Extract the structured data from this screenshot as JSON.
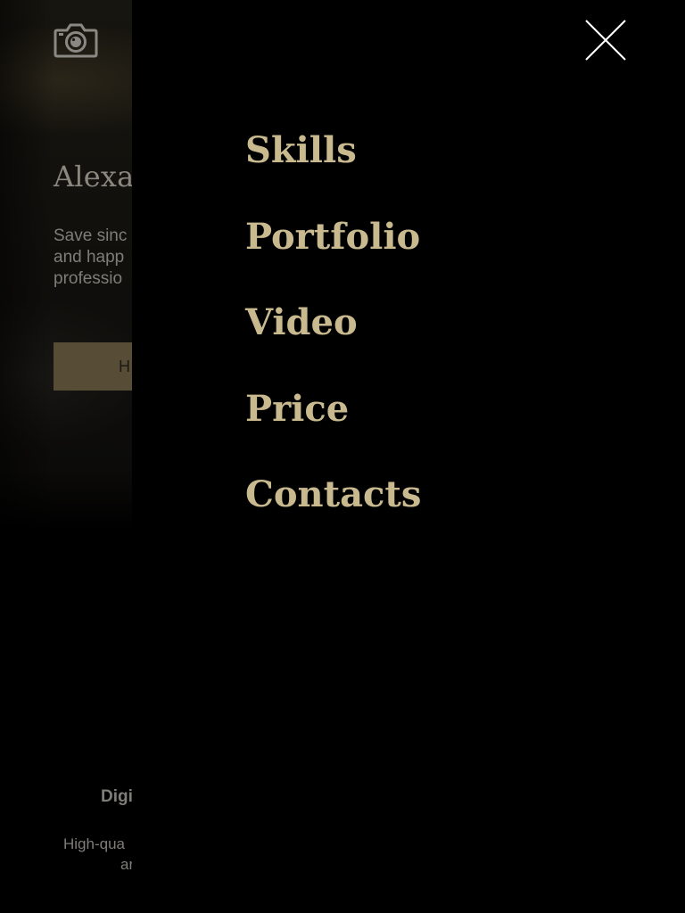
{
  "background_page": {
    "logo_icon": "camera-icon",
    "hero": {
      "title": "Alexa",
      "text_lines": [
        "Save sinc",
        "and happ",
        "professio"
      ],
      "button_label": "H"
    },
    "feature": {
      "title": "Digi",
      "text_lines": [
        "High-qua",
        "ar"
      ]
    }
  },
  "menu": {
    "close_icon": "close-icon",
    "items": [
      {
        "label": "Skills"
      },
      {
        "label": "Portfolio"
      },
      {
        "label": "Video"
      },
      {
        "label": "Price"
      },
      {
        "label": "Contacts"
      }
    ]
  },
  "colors": {
    "menu_background": "#000000",
    "menu_item": "#c9b98f",
    "close_icon": "#ffffff",
    "hero_button": "#574c36"
  }
}
